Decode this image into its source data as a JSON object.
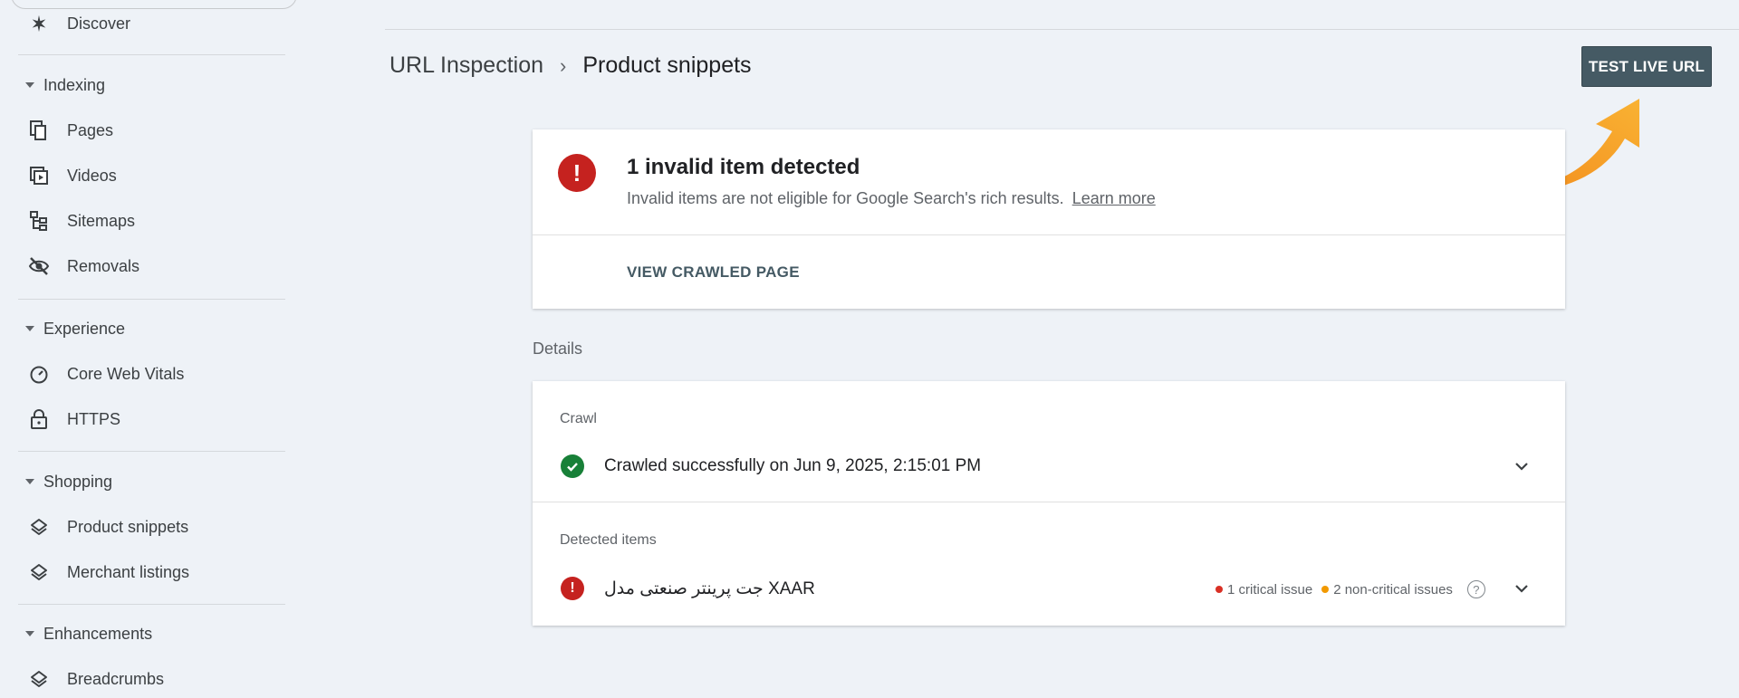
{
  "sidebar": {
    "items_top": [
      {
        "label": "Discover",
        "icon": "discover-icon"
      }
    ],
    "sections": [
      {
        "title": "Indexing",
        "items": [
          {
            "label": "Pages",
            "icon": "pages-icon"
          },
          {
            "label": "Videos",
            "icon": "videos-icon"
          },
          {
            "label": "Sitemaps",
            "icon": "sitemaps-icon"
          },
          {
            "label": "Removals",
            "icon": "removals-icon"
          }
        ]
      },
      {
        "title": "Experience",
        "items": [
          {
            "label": "Core Web Vitals",
            "icon": "gauge-icon"
          },
          {
            "label": "HTTPS",
            "icon": "lock-icon"
          }
        ]
      },
      {
        "title": "Shopping",
        "items": [
          {
            "label": "Product snippets",
            "icon": "layers-icon"
          },
          {
            "label": "Merchant listings",
            "icon": "layers-icon"
          }
        ]
      },
      {
        "title": "Enhancements",
        "items": [
          {
            "label": "Breadcrumbs",
            "icon": "layers-icon"
          }
        ]
      }
    ]
  },
  "header": {
    "breadcrumb_parent": "URL Inspection",
    "breadcrumb_sep": "›",
    "breadcrumb_current": "Product snippets",
    "test_live_url": "TEST LIVE URL",
    "accent_color": "#455a64"
  },
  "summary": {
    "title": "1 invalid item detected",
    "subtitle": "Invalid items are not eligible for Google Search's rich results.",
    "learn_more": "Learn more",
    "view_crawled": "VIEW CRAWLED PAGE",
    "error_color": "#c5221f"
  },
  "details": {
    "label": "Details",
    "crawl": {
      "title": "Crawl",
      "status": "Crawled successfully on Jun 9, 2025, 2:15:01 PM",
      "success_color": "#188038"
    },
    "detected": {
      "title": "Detected items",
      "item_name": "جت پرینتر صنعتی مدل XAAR",
      "critical": "1 critical issue",
      "non_critical": "2 non-critical issues",
      "critical_color": "#d93025",
      "non_critical_color": "#f29900"
    }
  }
}
